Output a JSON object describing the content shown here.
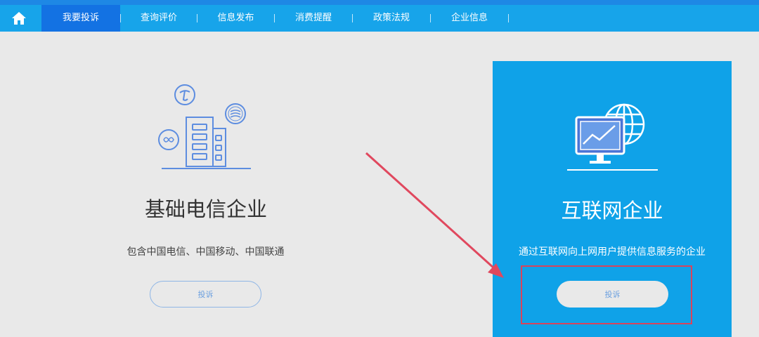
{
  "nav": {
    "items": [
      {
        "label": "我要投诉",
        "active": true
      },
      {
        "label": "查询评价",
        "active": false
      },
      {
        "label": "信息发布",
        "active": false
      },
      {
        "label": "消费提醒",
        "active": false
      },
      {
        "label": "政策法规",
        "active": false
      },
      {
        "label": "企业信息",
        "active": false
      }
    ],
    "home_icon": "home-icon"
  },
  "cards": {
    "telecom": {
      "title": "基础电信企业",
      "description": "包含中国电信、中国移动、中国联通",
      "button_label": "投诉",
      "icon": "telecom-building-icon"
    },
    "internet": {
      "title": "互联网企业",
      "description": "通过互联网向上网用户提供信息服务的企业",
      "button_label": "投诉",
      "icon": "monitor-globe-icon"
    }
  },
  "colors": {
    "nav_bg": "#17a4ea",
    "nav_active": "#1372e3",
    "card_blue": "#0fa2e8",
    "annotation_red": "#d9435b"
  }
}
